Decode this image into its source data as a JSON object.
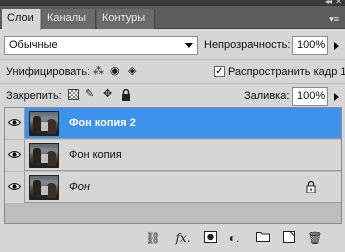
{
  "tabs": [
    {
      "label": "Слои",
      "active": true
    },
    {
      "label": "Каналы",
      "active": false
    },
    {
      "label": "Контуры",
      "active": false
    }
  ],
  "blend_mode": {
    "value": "Обычные"
  },
  "opacity": {
    "label": "Непрозрачность:",
    "value": "100%"
  },
  "unify": {
    "label": "Унифицировать:"
  },
  "propagate": {
    "label": "Распространить кадр 1",
    "checked": true
  },
  "lock": {
    "label": "Закрепить:"
  },
  "fill": {
    "label": "Заливка:",
    "value": "100%"
  },
  "layers": [
    {
      "name": "Фон копия 2",
      "selected": true,
      "visible": true,
      "italic": false,
      "locked": false
    },
    {
      "name": "Фон копия",
      "selected": false,
      "visible": true,
      "italic": false,
      "locked": false
    },
    {
      "name": "Фон",
      "selected": false,
      "visible": true,
      "italic": true,
      "locked": true
    }
  ],
  "colors": {
    "selection": "#3d93ec",
    "panel": "#d6d6d6",
    "tabbar": "#5c5c5c"
  },
  "bottom_icons": [
    "link-icon",
    "fx-icon",
    "mask-icon",
    "adjustment-icon",
    "group-folder-icon",
    "new-layer-icon",
    "trash-icon"
  ]
}
